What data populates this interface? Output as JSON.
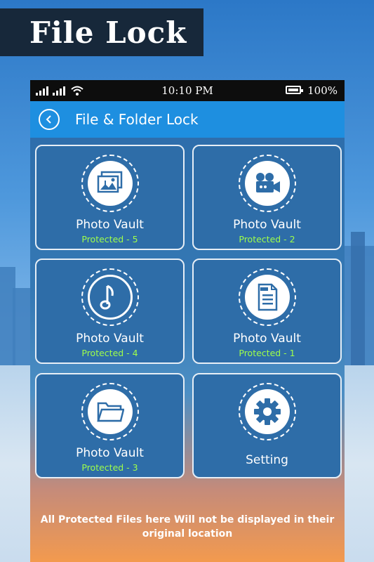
{
  "banner": {
    "title": "File Lock"
  },
  "status_bar": {
    "time": "10:10 PM",
    "battery": "100%"
  },
  "app_bar": {
    "title": "File & Folder Lock"
  },
  "tiles": [
    {
      "label": "Photo Vault",
      "sub": "Protected - 5",
      "icon": "photo-gallery-icon"
    },
    {
      "label": "Photo Vault",
      "sub": "Protected - 2",
      "icon": "video-camera-icon"
    },
    {
      "label": "Photo Vault",
      "sub": "Protected - 4",
      "icon": "music-note-icon"
    },
    {
      "label": "Photo Vault",
      "sub": "Protected - 1",
      "icon": "file-document-icon"
    },
    {
      "label": "Photo Vault",
      "sub": "Protected - 3",
      "icon": "folder-icon"
    },
    {
      "label": "Setting",
      "icon": "gear-icon"
    }
  ],
  "footer": {
    "text": "All Protected Files here Will not be displayed in their original location"
  },
  "colors": {
    "accent": "#1e8fe0",
    "tile": "#2e6da8",
    "protected_text": "#9fff4a",
    "banner": "#17283a"
  }
}
